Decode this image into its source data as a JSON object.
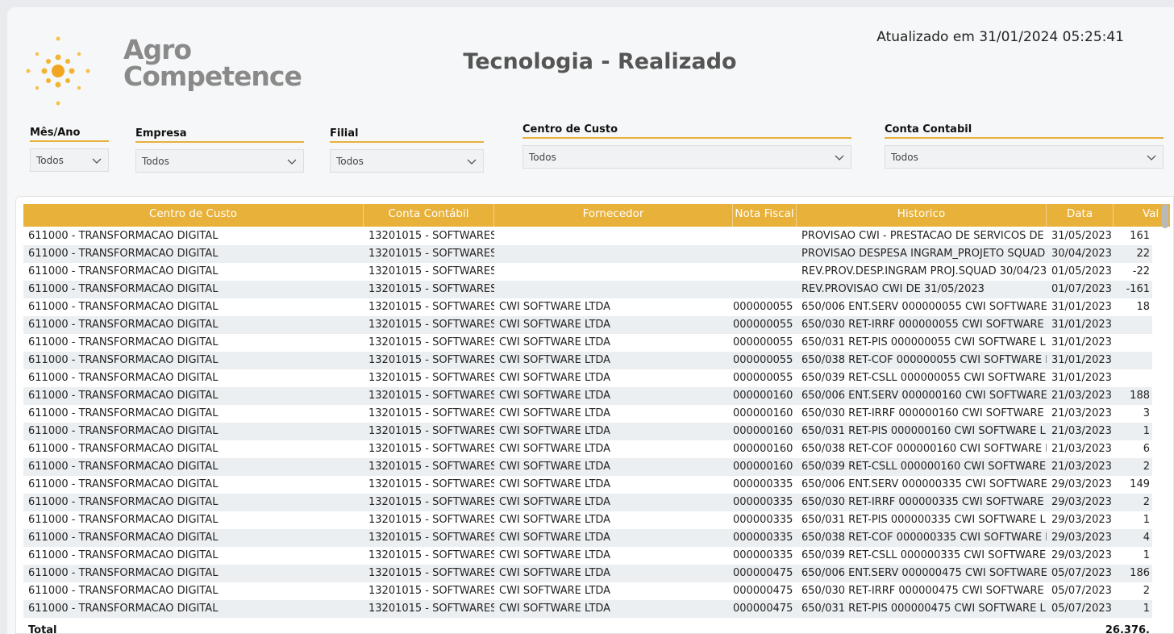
{
  "logo": {
    "line1": "Agro",
    "line2": "Competence"
  },
  "header": {
    "title": "Tecnologia - Realizado",
    "updated": "Atualizado em 31/01/2024 05:25:41"
  },
  "filters": [
    {
      "label": "Mês/Ano",
      "value": "Todos"
    },
    {
      "label": "Empresa",
      "value": "Todos"
    },
    {
      "label": "Filial",
      "value": "Todos"
    },
    {
      "label": "Centro de Custo",
      "value": "Todos"
    },
    {
      "label": "Conta Contabil",
      "value": "Todos"
    }
  ],
  "colors": {
    "accent": "#e8b13a",
    "row_alt": "#eceff1"
  },
  "table": {
    "columns": [
      "Centro de Custo",
      "Conta Contábil",
      "Fornecedor",
      "Nota Fiscal",
      "Historico",
      "Data",
      "Val"
    ],
    "rows": [
      [
        "611000 - TRANSFORMACAO DIGITAL",
        "13201015 - SOFTWARES",
        "",
        "",
        "PROVISAO CWI - PRESTACAO DE SERVICOS DE",
        "31/05/2023",
        "161"
      ],
      [
        "611000 - TRANSFORMACAO DIGITAL",
        "13201015 - SOFTWARES",
        "",
        "",
        "PROVISAO DESPESA INGRAM_PROJETO SQUAD",
        "30/04/2023",
        "22"
      ],
      [
        "611000 - TRANSFORMACAO DIGITAL",
        "13201015 - SOFTWARES",
        "",
        "",
        "REV.PROV.DESP.INGRAM PROJ.SQUAD 30/04/23",
        "01/05/2023",
        "-22"
      ],
      [
        "611000 - TRANSFORMACAO DIGITAL",
        "13201015 - SOFTWARES",
        "",
        "",
        "REV.PROVISAO CWI DE 31/05/2023",
        "01/07/2023",
        "-161"
      ],
      [
        "611000 - TRANSFORMACAO DIGITAL",
        "13201015 - SOFTWARES",
        "CWI SOFTWARE LTDA",
        "000000055",
        "650/006 ENT.SERV 000000055 CWI SOFTWARE",
        "31/01/2023",
        "18"
      ],
      [
        "611000 - TRANSFORMACAO DIGITAL",
        "13201015 - SOFTWARES",
        "CWI SOFTWARE LTDA",
        "000000055",
        "650/030 RET-IRRF 000000055 CWI SOFTWARE",
        "31/01/2023",
        ""
      ],
      [
        "611000 - TRANSFORMACAO DIGITAL",
        "13201015 - SOFTWARES",
        "CWI SOFTWARE LTDA",
        "000000055",
        "650/031 RET-PIS 000000055 CWI SOFTWARE L",
        "31/01/2023",
        ""
      ],
      [
        "611000 - TRANSFORMACAO DIGITAL",
        "13201015 - SOFTWARES",
        "CWI SOFTWARE LTDA",
        "000000055",
        "650/038 RET-COF 000000055 CWI SOFTWARE L",
        "31/01/2023",
        ""
      ],
      [
        "611000 - TRANSFORMACAO DIGITAL",
        "13201015 - SOFTWARES",
        "CWI SOFTWARE LTDA",
        "000000055",
        "650/039 RET-CSLL 000000055 CWI SOFTWARE",
        "31/01/2023",
        ""
      ],
      [
        "611000 - TRANSFORMACAO DIGITAL",
        "13201015 - SOFTWARES",
        "CWI SOFTWARE LTDA",
        "000000160",
        "650/006 ENT.SERV 000000160 CWI SOFTWARE",
        "21/03/2023",
        "188"
      ],
      [
        "611000 - TRANSFORMACAO DIGITAL",
        "13201015 - SOFTWARES",
        "CWI SOFTWARE LTDA",
        "000000160",
        "650/030 RET-IRRF 000000160 CWI SOFTWARE",
        "21/03/2023",
        "3"
      ],
      [
        "611000 - TRANSFORMACAO DIGITAL",
        "13201015 - SOFTWARES",
        "CWI SOFTWARE LTDA",
        "000000160",
        "650/031 RET-PIS 000000160 CWI SOFTWARE L",
        "21/03/2023",
        "1"
      ],
      [
        "611000 - TRANSFORMACAO DIGITAL",
        "13201015 - SOFTWARES",
        "CWI SOFTWARE LTDA",
        "000000160",
        "650/038 RET-COF 000000160 CWI SOFTWARE L",
        "21/03/2023",
        "6"
      ],
      [
        "611000 - TRANSFORMACAO DIGITAL",
        "13201015 - SOFTWARES",
        "CWI SOFTWARE LTDA",
        "000000160",
        "650/039 RET-CSLL 000000160 CWI SOFTWARE",
        "21/03/2023",
        "2"
      ],
      [
        "611000 - TRANSFORMACAO DIGITAL",
        "13201015 - SOFTWARES",
        "CWI SOFTWARE LTDA",
        "000000335",
        "650/006 ENT.SERV 000000335 CWI SOFTWARE",
        "29/03/2023",
        "149"
      ],
      [
        "611000 - TRANSFORMACAO DIGITAL",
        "13201015 - SOFTWARES",
        "CWI SOFTWARE LTDA",
        "000000335",
        "650/030 RET-IRRF 000000335 CWI SOFTWARE",
        "29/03/2023",
        "2"
      ],
      [
        "611000 - TRANSFORMACAO DIGITAL",
        "13201015 - SOFTWARES",
        "CWI SOFTWARE LTDA",
        "000000335",
        "650/031 RET-PIS 000000335 CWI SOFTWARE L",
        "29/03/2023",
        "1"
      ],
      [
        "611000 - TRANSFORMACAO DIGITAL",
        "13201015 - SOFTWARES",
        "CWI SOFTWARE LTDA",
        "000000335",
        "650/038 RET-COF 000000335 CWI SOFTWARE L",
        "29/03/2023",
        "4"
      ],
      [
        "611000 - TRANSFORMACAO DIGITAL",
        "13201015 - SOFTWARES",
        "CWI SOFTWARE LTDA",
        "000000335",
        "650/039 RET-CSLL 000000335 CWI SOFTWARE",
        "29/03/2023",
        "1"
      ],
      [
        "611000 - TRANSFORMACAO DIGITAL",
        "13201015 - SOFTWARES",
        "CWI SOFTWARE LTDA",
        "000000475",
        "650/006 ENT.SERV 000000475 CWI SOFTWARE",
        "05/07/2023",
        "186"
      ],
      [
        "611000 - TRANSFORMACAO DIGITAL",
        "13201015 - SOFTWARES",
        "CWI SOFTWARE LTDA",
        "000000475",
        "650/030 RET-IRRF 000000475 CWI SOFTWARE",
        "05/07/2023",
        "2"
      ],
      [
        "611000 - TRANSFORMACAO DIGITAL",
        "13201015 - SOFTWARES",
        "CWI SOFTWARE LTDA",
        "000000475",
        "650/031 RET-PIS 000000475 CWI SOFTWARE L",
        "05/07/2023",
        "1"
      ]
    ],
    "total_label": "Total",
    "total_value": "26.376."
  }
}
